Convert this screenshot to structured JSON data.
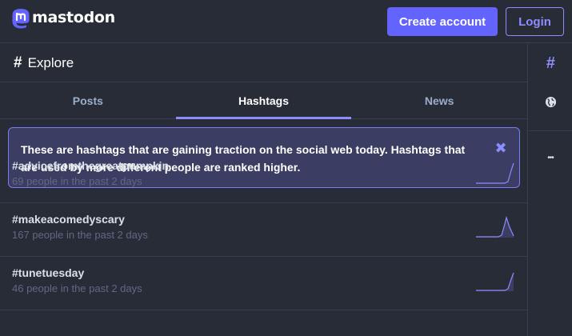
{
  "brand": {
    "name": "mastodon"
  },
  "header": {
    "create_account": "Create account",
    "login": "Login"
  },
  "column": {
    "hash_glyph": "#",
    "title": "Explore"
  },
  "tabs": [
    {
      "label": "Posts",
      "active": false
    },
    {
      "label": "Hashtags",
      "active": true
    },
    {
      "label": "News",
      "active": false
    }
  ],
  "notice": {
    "text": "These are hashtags that are gaining traction on the social web today. Hashtags that are used by more different people are ranked higher.",
    "close_glyph": "✖"
  },
  "hashtags": [
    {
      "name": "#advicefromthegreatpumpkin",
      "count": "69",
      "suffix": " people in the past 2 days"
    },
    {
      "name": "#makeacomedyscary",
      "count": "167",
      "suffix": " people in the past 2 days"
    },
    {
      "name": "#tunetuesday",
      "count": "46",
      "suffix": " people in the past 2 days"
    }
  ],
  "sidebar": {
    "icons": [
      "hashtag-icon",
      "globe-icon",
      "more-icon"
    ],
    "hash_glyph": "#",
    "more_glyph": "•••"
  },
  "colors": {
    "background": "#282c37",
    "accent": "#6364ff",
    "accent_light": "#8c8dff",
    "notice_bg": "#3b3d62",
    "muted_text": "#606984",
    "tab_text": "#9baec8"
  }
}
